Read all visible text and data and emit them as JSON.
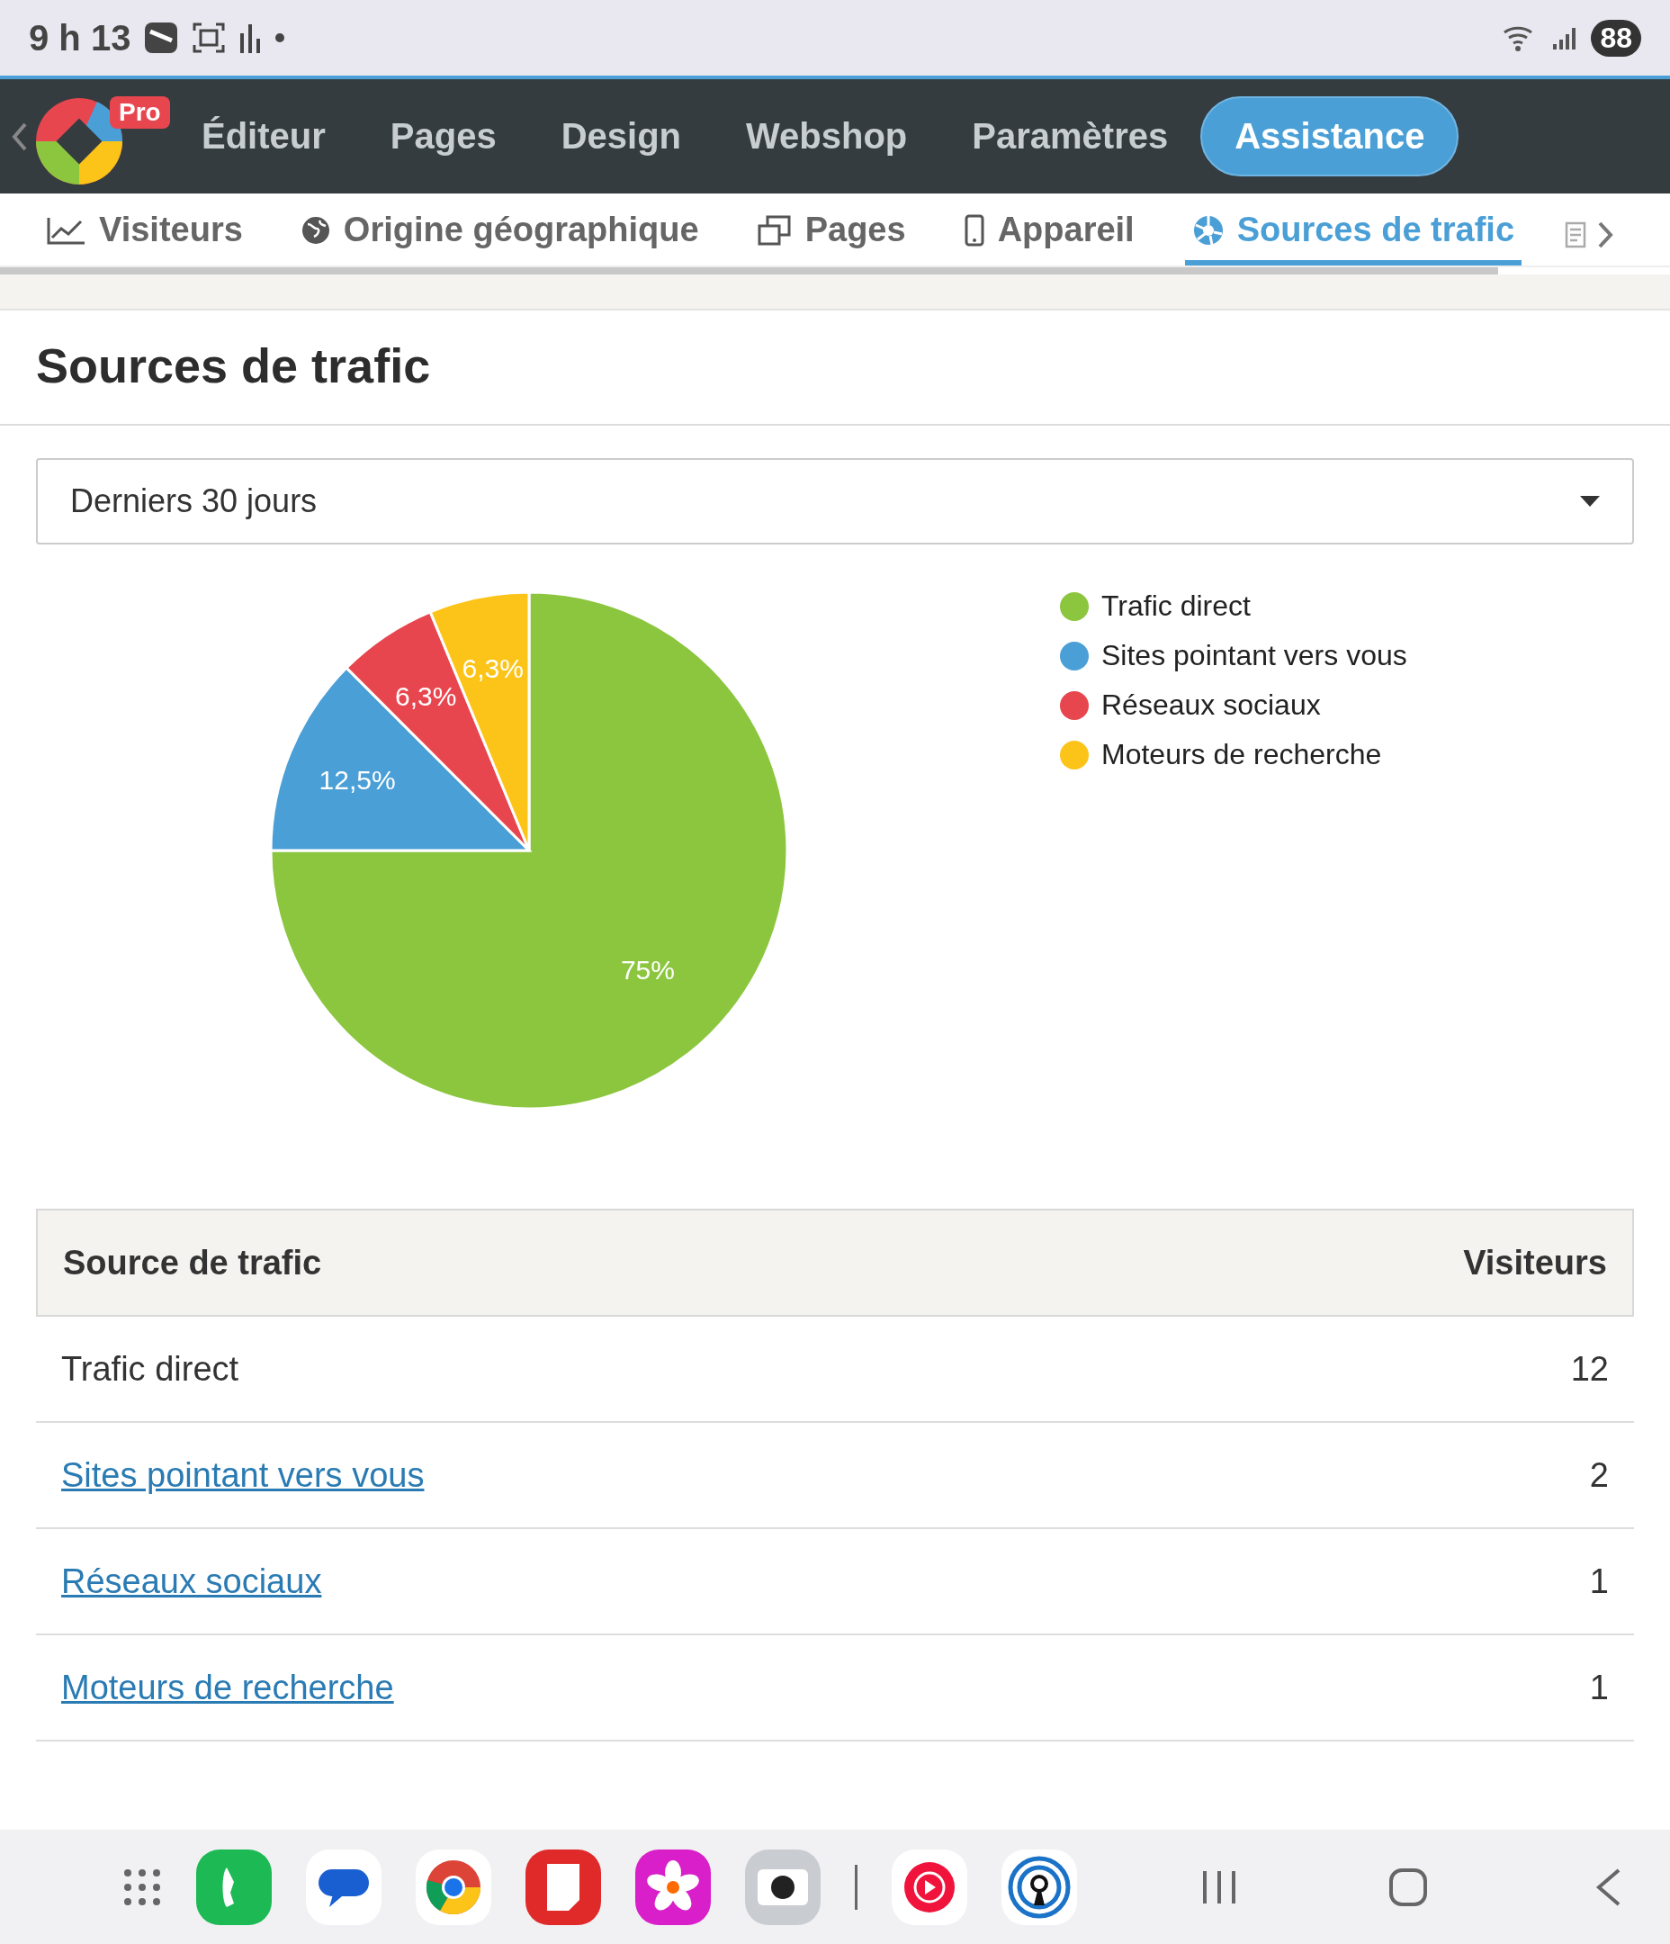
{
  "status_bar": {
    "time": "9 h 13",
    "battery": "88"
  },
  "nav": {
    "badge": "Pro",
    "items": [
      {
        "label": "Éditeur",
        "selected": false
      },
      {
        "label": "Pages",
        "selected": false
      },
      {
        "label": "Design",
        "selected": false
      },
      {
        "label": "Webshop",
        "selected": false
      },
      {
        "label": "Paramètres",
        "selected": false
      },
      {
        "label": "Assistance",
        "selected": true
      }
    ]
  },
  "tabs": [
    {
      "label": "Visiteurs",
      "kind": "chart",
      "selected": false
    },
    {
      "label": "Origine géographique",
      "kind": "globe",
      "selected": false
    },
    {
      "label": "Pages",
      "kind": "pages",
      "selected": false
    },
    {
      "label": "Appareil",
      "kind": "phone",
      "selected": false
    },
    {
      "label": "Sources de trafic",
      "kind": "sources",
      "selected": true
    }
  ],
  "page_title": "Sources de trafic",
  "period_select": {
    "value": "Derniers 30 jours"
  },
  "chart_data": {
    "type": "pie",
    "categories": [
      "Trafic direct",
      "Sites pointant vers vous",
      "Réseaux sociaux",
      "Moteurs de recherche"
    ],
    "values": [
      75,
      12.5,
      6.25,
      6.25
    ],
    "legend": "right",
    "colors": [
      "#8cc63f",
      "#4a9fd6",
      "#e8464e",
      "#fcc419"
    ],
    "value_labels": [
      "75%",
      "12,5%",
      "6,3%",
      "6,3%"
    ]
  },
  "table": {
    "columns": [
      "Source de trafic",
      "Visiteurs"
    ],
    "rows": [
      {
        "source": "Trafic direct",
        "kind": "text",
        "visitors": "12"
      },
      {
        "source": "Sites pointant vers vous",
        "kind": "link",
        "visitors": "2"
      },
      {
        "source": "Réseaux sociaux",
        "kind": "link",
        "visitors": "1"
      },
      {
        "source": "Moteurs de recherche",
        "kind": "link",
        "visitors": "1"
      }
    ]
  }
}
